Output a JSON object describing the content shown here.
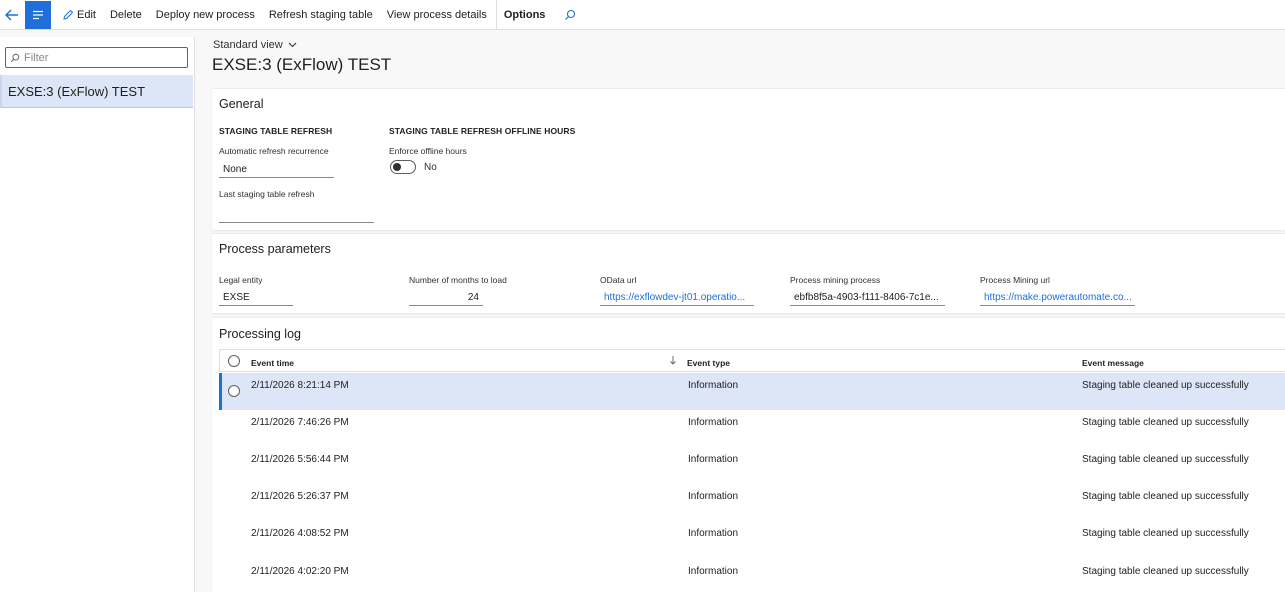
{
  "commandbar": {
    "edit_label": "Edit",
    "delete_label": "Delete",
    "deploy_label": "Deploy new process",
    "refresh_label": "Refresh staging table",
    "view_details_label": "View process details",
    "options_label": "Options"
  },
  "leftpane": {
    "filter_placeholder": "Filter",
    "items": [
      {
        "label": "EXSE:3 (ExFlow) TEST"
      }
    ]
  },
  "header": {
    "view_name": "Standard view",
    "title": "EXSE:3 (ExFlow) TEST"
  },
  "general": {
    "title": "General",
    "staging_group": "STAGING TABLE REFRESH",
    "recurrence_label": "Automatic refresh recurrence",
    "recurrence_value": "None",
    "last_refresh_label": "Last staging table refresh",
    "last_refresh_value": "",
    "offline_group": "STAGING TABLE REFRESH OFFLINE HOURS",
    "enforce_label": "Enforce offline hours",
    "enforce_value": "No"
  },
  "parameters": {
    "title": "Process parameters",
    "legal_entity_label": "Legal entity",
    "legal_entity_value": "EXSE",
    "months_label": "Number of months to load",
    "months_value": "24",
    "odata_label": "OData url",
    "odata_value": "https://exflowdev-jt01.operatio...",
    "mining_process_label": "Process mining process",
    "mining_process_value": "ebfb8f5a-4903-f111-8406-7c1e...",
    "mining_url_label": "Process Mining url",
    "mining_url_value": "https://make.powerautomate.co..."
  },
  "log": {
    "title": "Processing log",
    "columns": {
      "event_time": "Event time",
      "event_type": "Event type",
      "event_message": "Event message"
    },
    "rows": [
      {
        "time": "2/11/2026 8:21:14 PM",
        "type": "Information",
        "message": "Staging table cleaned up successfully"
      },
      {
        "time": "2/11/2026 7:46:26 PM",
        "type": "Information",
        "message": "Staging table cleaned up successfully"
      },
      {
        "time": "2/11/2026 5:56:44 PM",
        "type": "Information",
        "message": "Staging table cleaned up successfully"
      },
      {
        "time": "2/11/2026 5:26:37 PM",
        "type": "Information",
        "message": "Staging table cleaned up successfully"
      },
      {
        "time": "2/11/2026 4:08:52 PM",
        "type": "Information",
        "message": "Staging table cleaned up successfully"
      },
      {
        "time": "2/11/2026 4:02:20 PM",
        "type": "Information",
        "message": "Staging table cleaned up successfully"
      }
    ]
  },
  "colors": {
    "accent": "#1e6fd9",
    "selected_row": "#dce6f7"
  },
  "icons": [
    "back-arrow-icon",
    "menu-icon",
    "pencil-icon",
    "search-icon",
    "chevron-down-icon",
    "sort-down-icon"
  ]
}
